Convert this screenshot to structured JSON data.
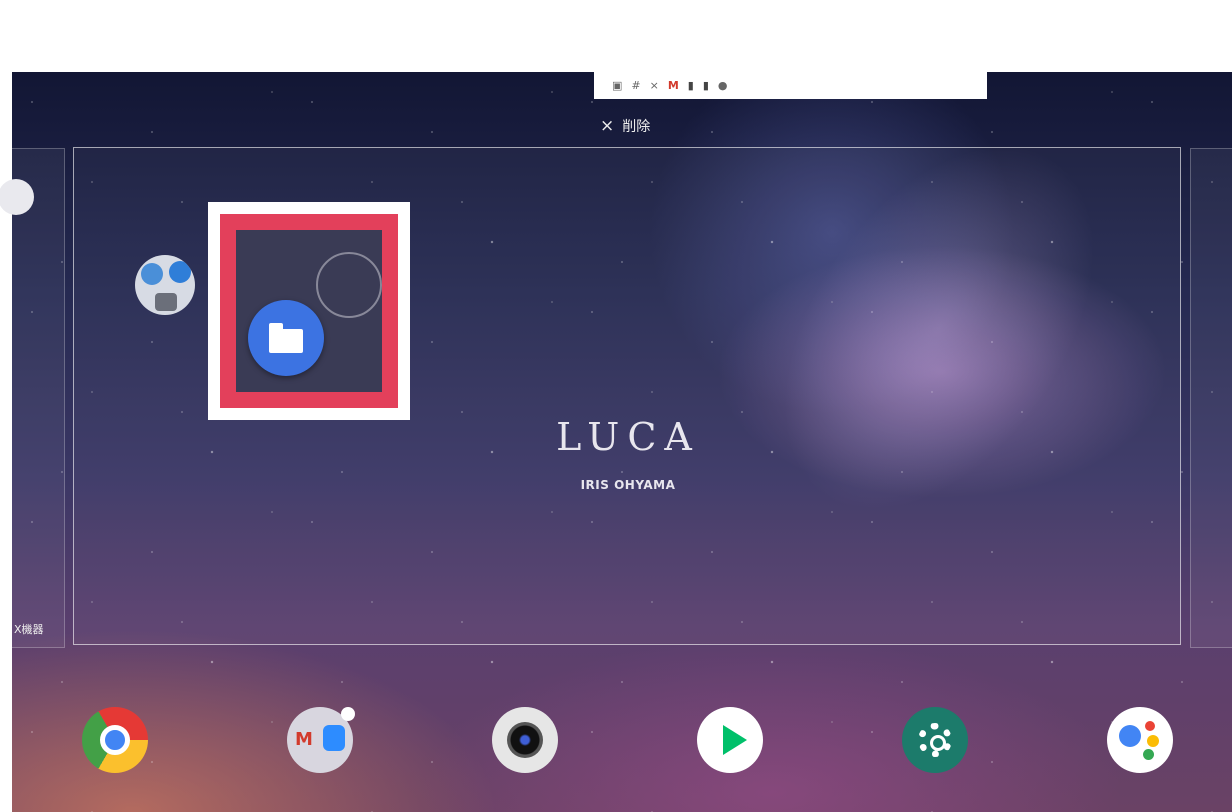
{
  "status_bar": {
    "icons": [
      "image-icon",
      "slack-icon",
      "close-icon",
      "gmail-icon",
      "notification-icon",
      "notification-icon",
      "mic-icon"
    ],
    "close_glyph": "×",
    "gmail_glyph": "M"
  },
  "delete_target": {
    "icon": "×",
    "label": "削除"
  },
  "left_page": {
    "label": "X機器"
  },
  "home_preview": {
    "brand_name": "LUCA",
    "brand_sub": "IRIS OHYAMA"
  },
  "dragged_app": {
    "name": "Files",
    "highlight_color": "#e3405b"
  },
  "dock": [
    {
      "name": "Chrome"
    },
    {
      "name": "Gmail / Zoom folder"
    },
    {
      "name": "Camera"
    },
    {
      "name": "Play Store"
    },
    {
      "name": "Settings"
    },
    {
      "name": "Assistant"
    }
  ],
  "colors": {
    "accent": "#e3405b",
    "files_blue": "#3c73e2",
    "settings_green": "#1c7b6b"
  }
}
